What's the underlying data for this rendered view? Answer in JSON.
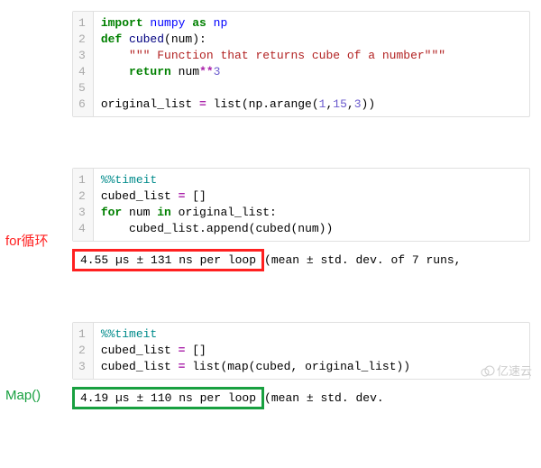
{
  "top_block": {
    "lines": [
      "1",
      "2",
      "3",
      "4",
      "5",
      "6"
    ],
    "c1_kw1": "import",
    "c1_mod": " numpy ",
    "c1_kw2": "as",
    "c1_alias": " np",
    "c2_kw": "def",
    "c2_fn": " cubed",
    "c2_sig": "(num):",
    "c3_ind": "    ",
    "c3_doc": "\"\"\" Function that returns cube of a number\"\"\"",
    "c4_ind": "    ",
    "c4_kw": "return",
    "c4_expr": " num",
    "c4_op": "**",
    "c4_num": "3",
    "c5": "",
    "c6_pre": "original_list ",
    "c6_eq": "=",
    "c6_post": " list(np.arange(",
    "c6_n1": "1",
    "c6_c1": ",",
    "c6_n2": "15",
    "c6_c2": ",",
    "c6_n3": "3",
    "c6_close": "))"
  },
  "for_label": "for循环",
  "for_block": {
    "lines": [
      "1",
      "2",
      "3",
      "4"
    ],
    "c1_pct": "%%",
    "c1_magic": "timeit",
    "c2_pre": "cubed_list ",
    "c2_eq": "=",
    "c2_post": " []",
    "c3_kw1": "for",
    "c3_var": " num ",
    "c3_kw2": "in",
    "c3_iter": " original_list:",
    "c4_ind": "    ",
    "c4_call": "cubed_list.append(cubed(num))"
  },
  "for_output": {
    "highlight": "4.55 µs ± 131 ns per loop ",
    "rest": "(mean ± std. dev. of 7 runs,"
  },
  "map_label": "Map()",
  "map_block": {
    "lines": [
      "1",
      "2",
      "3"
    ],
    "c1_pct": "%%",
    "c1_magic": "timeit",
    "c2_pre": "cubed_list ",
    "c2_eq": "=",
    "c2_post": " []",
    "c3_pre": "cubed_list ",
    "c3_eq": "=",
    "c3_post": " list(map(cubed, original_list))"
  },
  "map_output": {
    "highlight": "4.19 µs ± 110 ns per loop ",
    "rest": "(mean ± std. dev."
  },
  "watermark": "亿速云"
}
